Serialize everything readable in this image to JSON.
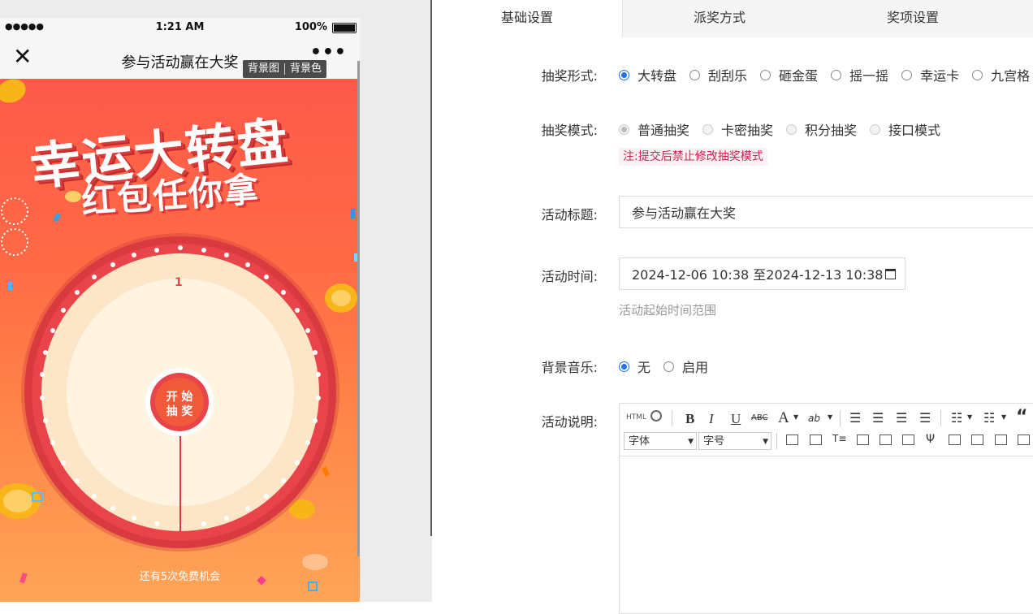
{
  "preview": {
    "status": {
      "signal": "●●●●●",
      "time": "1:21 AM",
      "battery": "100%"
    },
    "nav": {
      "close": "✕",
      "title": "参与活动赢在大奖",
      "more": "•••"
    },
    "bg_tags": [
      "背景图",
      "背景色"
    ],
    "headline_line1": "幸运大转盘",
    "headline_line2": "红包任你拿",
    "wheel_number": "1",
    "start_button": {
      "line1": "开 始",
      "line2": "抽 奖"
    },
    "chances": "还有5次免费机会"
  },
  "tabs": [
    "基础设置",
    "派奖方式",
    "奖项设置"
  ],
  "form": {
    "lottery_type": {
      "label": "抽奖形式:",
      "options": [
        "大转盘",
        "刮刮乐",
        "砸金蛋",
        "摇一摇",
        "幸运卡",
        "九宫格"
      ],
      "selected": "大转盘"
    },
    "lottery_mode": {
      "label": "抽奖模式:",
      "options": [
        "普通抽奖",
        "卡密抽奖",
        "积分抽奖",
        "接口模式"
      ],
      "selected": "普通抽奖",
      "notice": "注:提交后禁止修改抽奖模式"
    },
    "activity_title": {
      "label": "活动标题:",
      "value": "参与活动赢在大奖"
    },
    "activity_time": {
      "label": "活动时间:",
      "value": "2024-12-06 10:38 至2024-12-13 10:38",
      "hint": "活动起始时间范围"
    },
    "bg_music": {
      "label": "背景音乐:",
      "options": [
        "无",
        "启用"
      ],
      "selected": "无"
    },
    "description": {
      "label": "活动说明:",
      "font_select": "字体",
      "size_select": "字号",
      "html_label": "HTML"
    }
  },
  "colors": {
    "accent": "#1a73e8",
    "notice_text": "#c7254e",
    "wheel_red": "#e8373d"
  }
}
